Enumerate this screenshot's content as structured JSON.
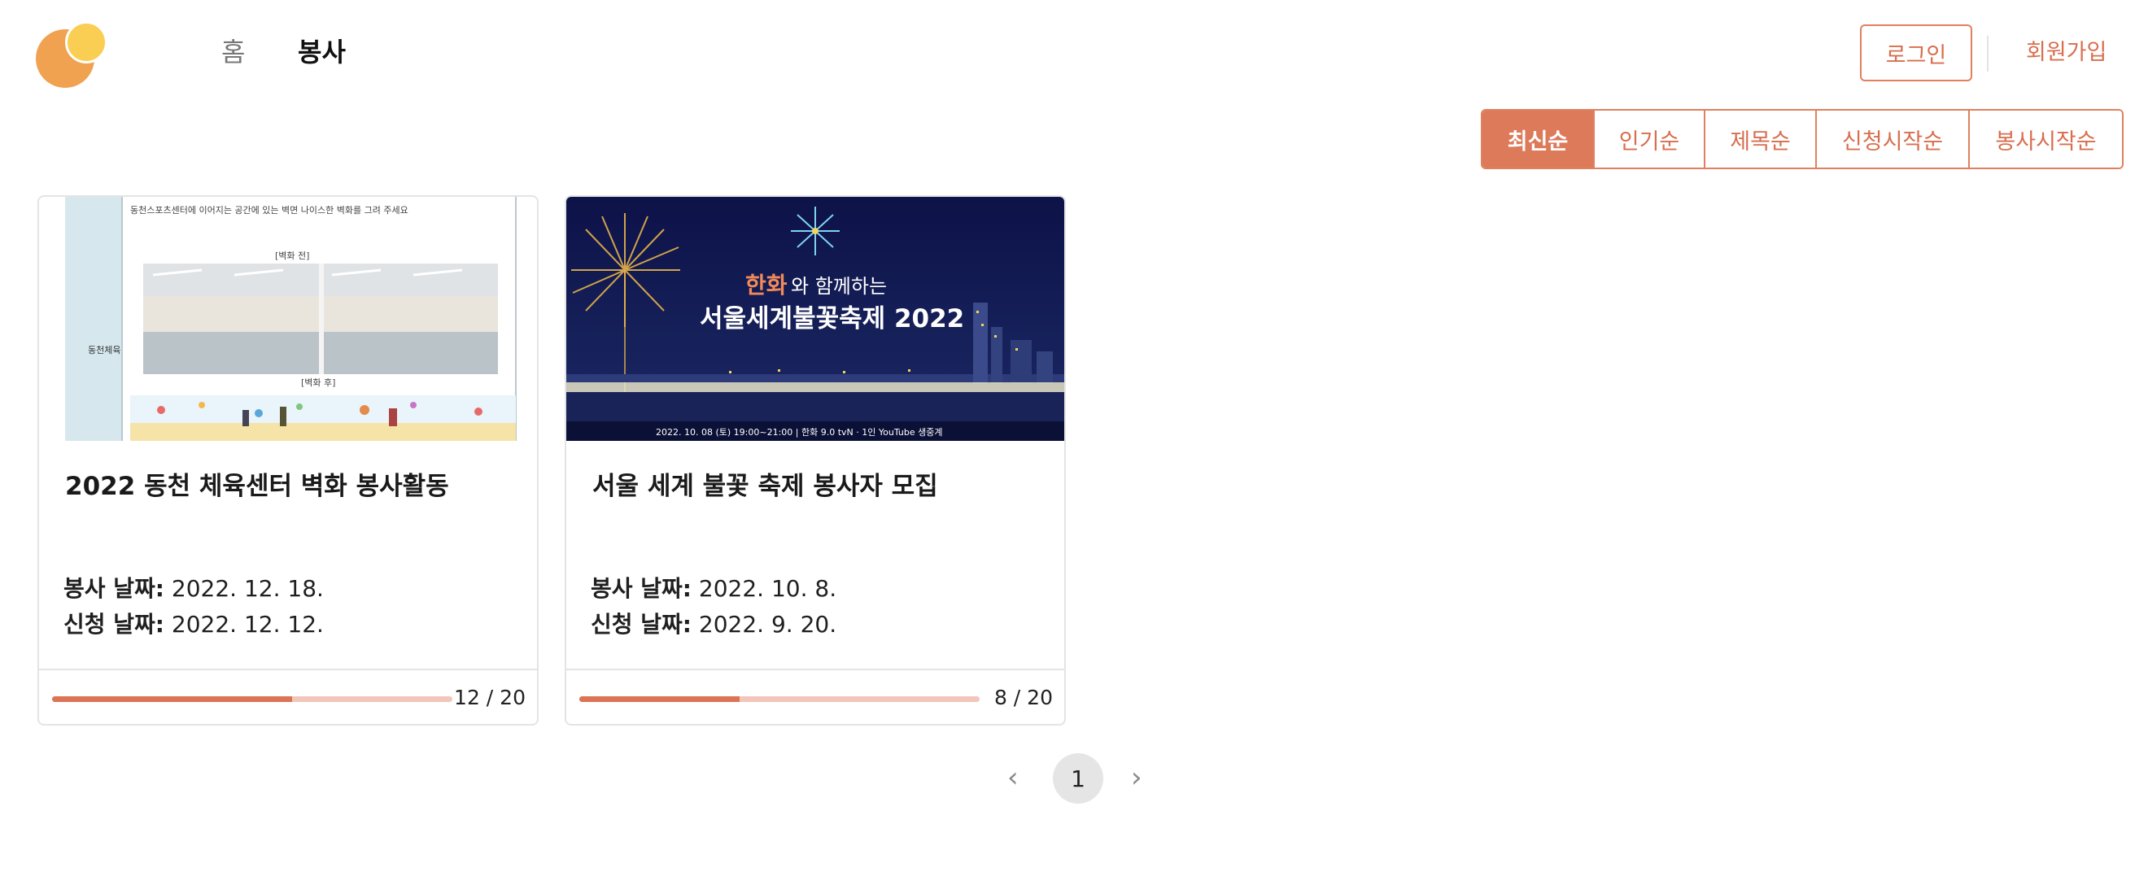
{
  "header": {
    "nav": {
      "home": "홈",
      "volunteer": "봉사"
    },
    "login": "로그인",
    "signup": "회원가입"
  },
  "sort": {
    "options": [
      "최신순",
      "인기순",
      "제목순",
      "신청시작순",
      "봉사시작순"
    ],
    "active": "최신순"
  },
  "cards": [
    {
      "title": "2022 동천 체육센터 벽화 봉사활동",
      "service_date_label": "봉사 날짜:",
      "service_date": "2022. 12. 18.",
      "apply_date_label": "신청 날짜:",
      "apply_date": "2022. 12. 12.",
      "current": 12,
      "capacity": 20,
      "count_text": "12 / 20",
      "image_text": {
        "top_caption": "동천스포츠센터에 이어지는 공간에 있는 벽면 나이스한 벽화를 그려 주세요",
        "label_before": "[벽화 전]",
        "label_after": "[벽화 후]",
        "side_label": "동천체육"
      }
    },
    {
      "title": "서울 세계 불꽃 축제 봉사자 모집",
      "service_date_label": "봉사 날짜:",
      "service_date": "2022. 10. 8.",
      "apply_date_label": "신청 날짜:",
      "apply_date": "2022. 9. 20.",
      "current": 8,
      "capacity": 20,
      "count_text": "8 / 20",
      "image_text": {
        "brand": "한화",
        "subtitle": "와 함께하는",
        "headline": "서울세계불꽃축제 2022",
        "footer": "2022. 10. 08 (토) 19:00~21:00  |  한화  9.0 tvN · 1인 YouTube 생중계"
      }
    }
  ],
  "pagination": {
    "prev": "‹",
    "current": "1",
    "next": "›"
  },
  "colors": {
    "accent": "#DD7A5A",
    "track": "#F2C7BA",
    "logo_orange": "#F0A250",
    "logo_yellow": "#F9CE53"
  }
}
